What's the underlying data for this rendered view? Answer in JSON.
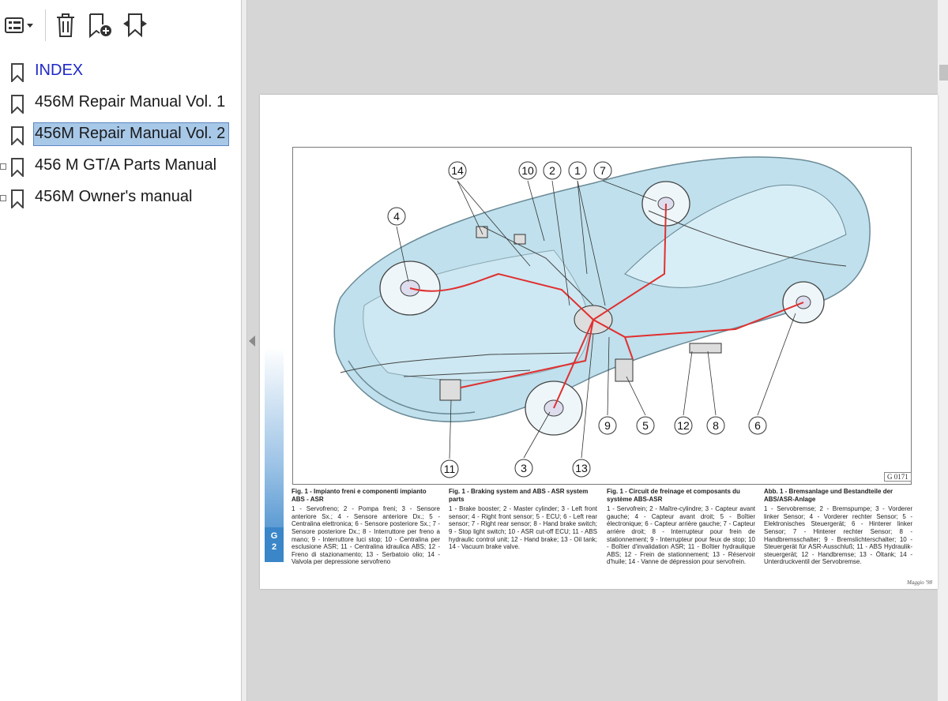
{
  "toolbar": {
    "options_icon": "list-options-icon",
    "delete_icon": "trash-icon",
    "add_bookmark_icon": "add-bookmark-icon",
    "find_bookmark_icon": "find-bookmark-icon"
  },
  "bookmarks": [
    {
      "label": "INDEX",
      "style": "link"
    },
    {
      "label": "456M Repair Manual Vol. 1",
      "style": "normal"
    },
    {
      "label": "456M Repair Manual Vol. 2",
      "style": "selected"
    },
    {
      "label": "456 M GT/A Parts Manual",
      "style": "expandable"
    },
    {
      "label": "456M Owner's manual",
      "style": "expandable"
    }
  ],
  "page": {
    "section_tab": "G\n2",
    "figure_code": "G 0171",
    "footer": "Maggio '98",
    "callouts": [
      "14",
      "10",
      "2",
      "1",
      "7",
      "4",
      "11",
      "3",
      "13",
      "9",
      "5",
      "12",
      "8",
      "6"
    ],
    "captions": [
      {
        "title": "Fig. 1 - Impianto freni e componenti impianto ABS - ASR",
        "body": "1 - Servofreno; 2 - Pompa freni; 3 - Sensore anteriore Sx.; 4 - Sensore anteriore Dx.; 5 - Centralina elettronica; 6 - Sensore posteriore Sx.; 7 - Sensore posteriore Dx.; 8 - Interruttore per freno a mano; 9 - Interruttore luci stop; 10 - Centralina per esclusione ASR; 11 - Centralina idraulica ABS; 12 - Freno di stazionamento; 13 - Serbatoio olio; 14 - Valvola per depressione servofreno"
      },
      {
        "title": "Fig. 1 - Braking system and ABS - ASR system parts",
        "body": "1 - Brake booster; 2 - Master cylinder; 3 - Left front sensor; 4 - Right front sensor; 5 - ECU; 6 - Left rear sensor; 7 - Right rear sensor; 8 - Hand brake switch; 9 - Stop light switch; 10 - ASR cut-off ECU; 11 - ABS hydraulic control unit; 12 - Hand brake; 13 - Oil tank; 14 - Vacuum brake valve."
      },
      {
        "title": "Fig. 1 - Circuit de freinage et composants du système ABS-ASR",
        "body": "1 - Servofrein; 2 - Maître-cylindre; 3 - Capteur avant gauche; 4 - Capteur avant droit; 5 - Boîtier électronique; 6 - Capteur arrière gauche; 7 - Capteur arrière droit; 8 - Interrupteur pour frein de stationnement; 9 - Interrupteur pour feux de stop; 10 - Boîtier d'invalidation ASR; 11 - Boîtier hydraulique ABS; 12 - Frein de stationnement; 13 - Réservoir d'huile; 14 - Vanne de dépression pour servofrein."
      },
      {
        "title": "Abb. 1 - Bremsanlage und Bestandteile der ABS/ASR-Anlage",
        "body": "1 - Servobremse; 2 - Bremspumpe; 3 - Vorderer linker Sensor; 4 - Vorderer rechter Sensor; 5 - Elektronisches Steuergerät; 6 - Hinterer linker Sensor; 7 - Hinterer rechter Sensor; 8 - Handbremsschalter; 9 - Bremslichterschalter; 10 - Steuergerät für ASR-Ausschluß; 11 - ABS Hydraulik-steuergerät; 12 - Handbremse; 13 - Öltank; 14 - Unterdruckventil der Servobremse."
      }
    ]
  },
  "colors": {
    "car_body": "#bfe0ec",
    "brake_line": "#e03030",
    "selected_bg": "#a8c8e8",
    "link": "#1f28c8",
    "section_tab": "#3a86c8"
  }
}
